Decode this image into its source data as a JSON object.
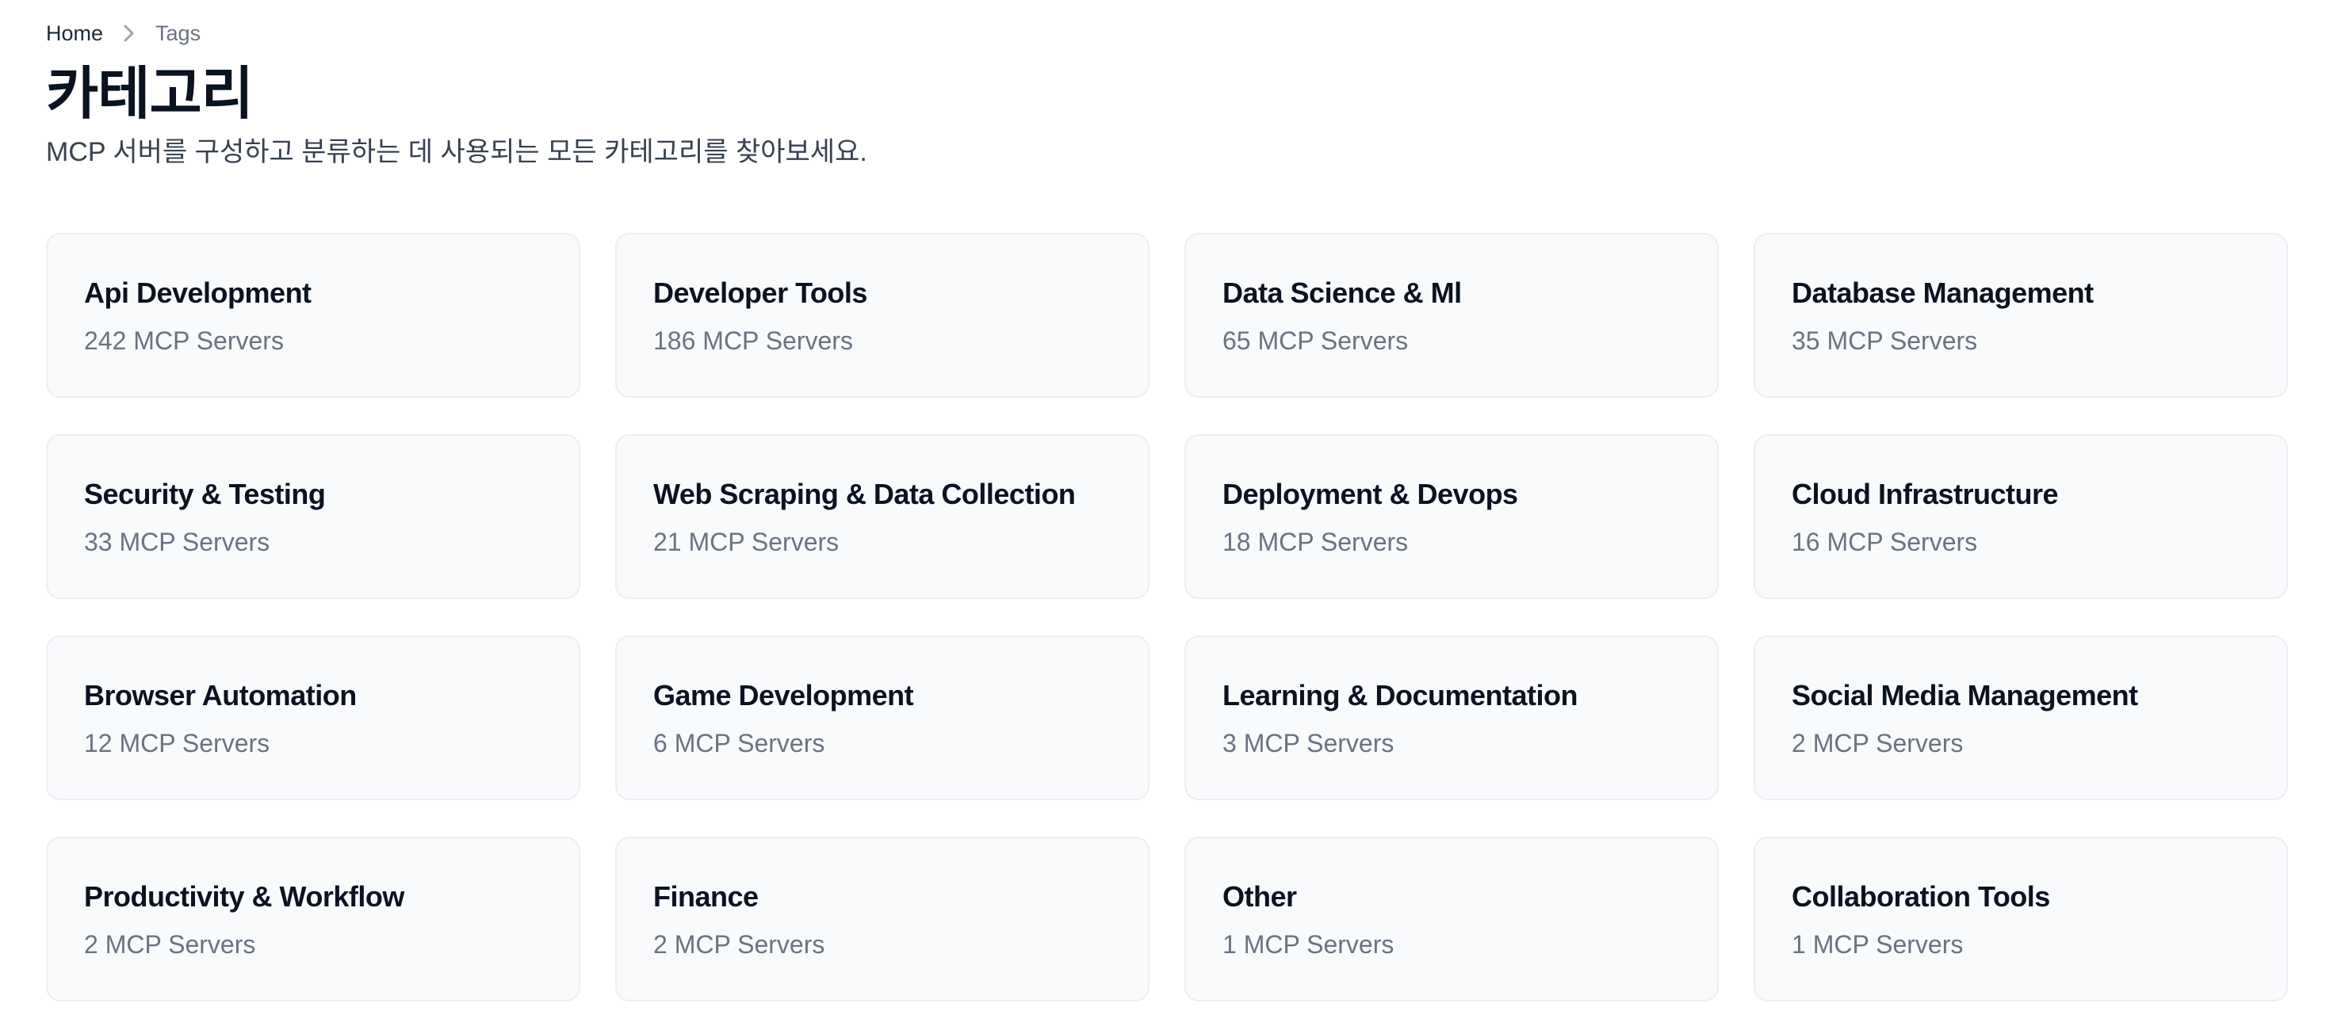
{
  "breadcrumb": {
    "home": "Home",
    "current": "Tags"
  },
  "header": {
    "title": "카테고리",
    "subtitle": "MCP 서버를 구성하고 분류하는 데 사용되는 모든 카테고리를 찾아보세요."
  },
  "categories": [
    {
      "title": "Api Development",
      "count": "242 MCP Servers"
    },
    {
      "title": "Developer Tools",
      "count": "186 MCP Servers"
    },
    {
      "title": "Data Science & Ml",
      "count": "65 MCP Servers"
    },
    {
      "title": "Database Management",
      "count": "35 MCP Servers"
    },
    {
      "title": "Security & Testing",
      "count": "33 MCP Servers"
    },
    {
      "title": "Web Scraping & Data Collection",
      "count": "21 MCP Servers"
    },
    {
      "title": "Deployment & Devops",
      "count": "18 MCP Servers"
    },
    {
      "title": "Cloud Infrastructure",
      "count": "16 MCP Servers"
    },
    {
      "title": "Browser Automation",
      "count": "12 MCP Servers"
    },
    {
      "title": "Game Development",
      "count": "6 MCP Servers"
    },
    {
      "title": "Learning & Documentation",
      "count": "3 MCP Servers"
    },
    {
      "title": "Social Media Management",
      "count": "2 MCP Servers"
    },
    {
      "title": "Productivity & Workflow",
      "count": "2 MCP Servers"
    },
    {
      "title": "Finance",
      "count": "2 MCP Servers"
    },
    {
      "title": "Other",
      "count": "1 MCP Servers"
    },
    {
      "title": "Collaboration Tools",
      "count": "1 MCP Servers"
    }
  ],
  "icons": {
    "breadcrumb_separator": "chevron-right-icon"
  },
  "colors": {
    "card_background": "#f8fafc",
    "card_border": "#eceef2",
    "title_text": "#0b1220",
    "muted_text": "#6b7280"
  }
}
